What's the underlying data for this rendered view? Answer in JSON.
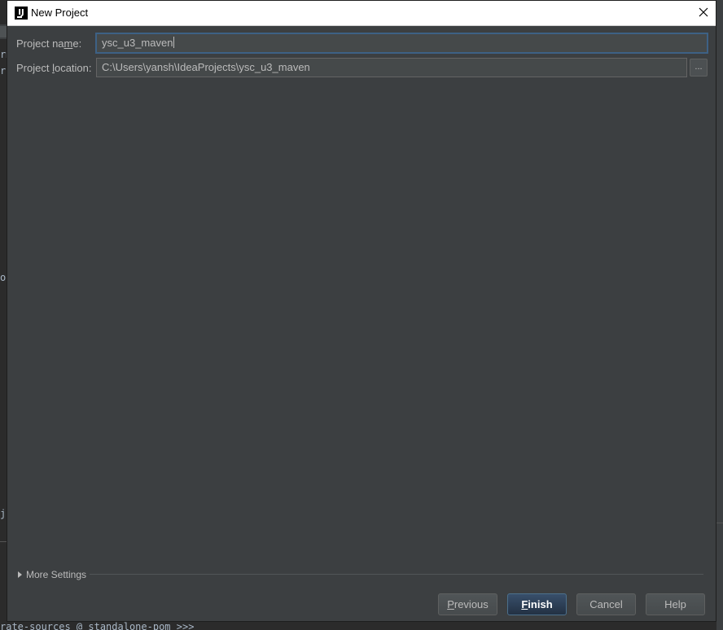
{
  "window": {
    "title": "New Project",
    "icon": "intellij-idea-icon",
    "close_icon": "close-icon"
  },
  "form": {
    "project_name": {
      "label_pre": "Project na",
      "label_mnemonic": "m",
      "label_post": "e:",
      "value": "ysc_u3_maven"
    },
    "project_location": {
      "label_pre": "Project ",
      "label_mnemonic": "l",
      "label_post": "ocation:",
      "value": "C:\\Users\\yansh\\IdeaProjects\\ysc_u3_maven",
      "browse_label": "..."
    }
  },
  "more_settings": {
    "label": "More Settings",
    "icon": "expand-triangle-icon"
  },
  "buttons": {
    "previous": {
      "mnemonic": "P",
      "rest": "revious"
    },
    "finish": {
      "mnemonic": "F",
      "rest": "inish"
    },
    "cancel": {
      "label": "Cancel"
    },
    "help": {
      "label": "Help"
    }
  },
  "background": {
    "console_line": "rate-sources @ standalone-pom >>>",
    "glyphs": [
      "rm",
      "ro",
      "oi",
      "je"
    ]
  },
  "colors": {
    "dialog_bg": "#3c3f41",
    "field_bg": "#45494a",
    "focus_border": "#3d6185",
    "default_button": "#365880"
  }
}
